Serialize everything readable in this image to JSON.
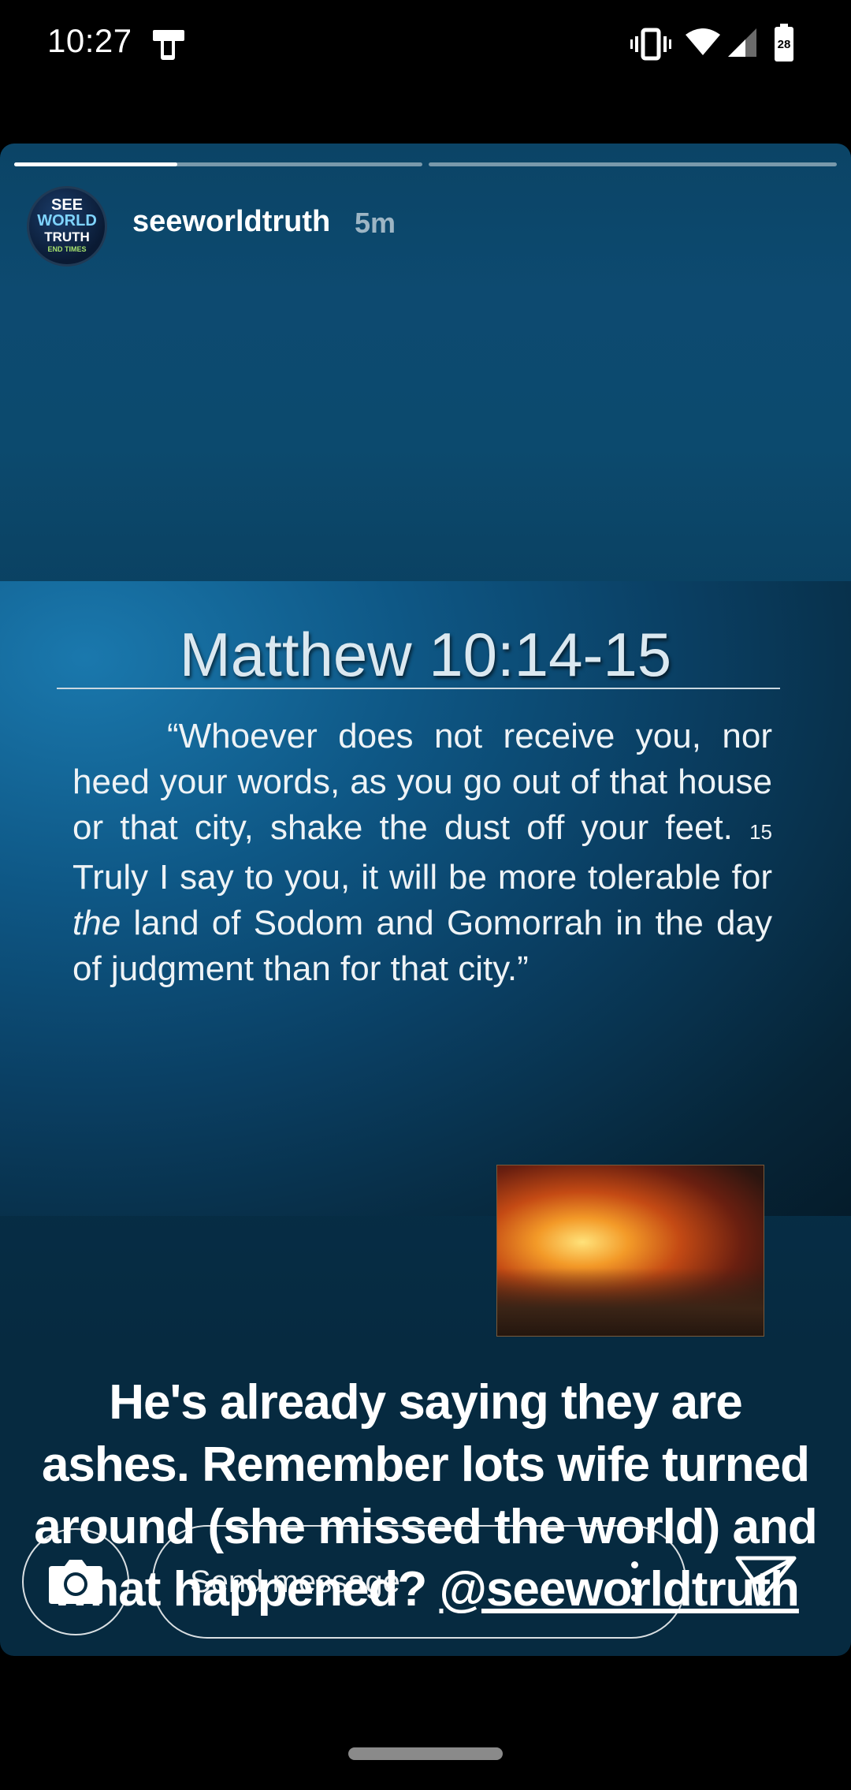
{
  "status_bar": {
    "time": "10:27",
    "battery_level": "28",
    "icons": [
      "screenshot-device-icon",
      "vibrate-icon",
      "wifi-icon",
      "cell-signal-icon",
      "battery-icon"
    ]
  },
  "story": {
    "progress": [
      {
        "fill": 0.4
      },
      {
        "fill": 0
      }
    ],
    "avatar_lines": [
      "SEE",
      "WORLD",
      "TRUTH",
      "END TIMES"
    ],
    "username": "seeworldtruth",
    "time_ago": "5m",
    "slide": {
      "title": "Matthew 10:14-15",
      "verse_part1": "“Whoever does not receive you, nor heed your words, as you go out of that house or that city, shake the dust off your feet. ",
      "verse_number": "15",
      "verse_part2": " Truly I say to you, it will be more tolerable for ",
      "verse_italic": "the",
      "verse_part3": " land of Sodom and Gomorrah in the day of judgment than for that city.”"
    },
    "caption_text": "He's already saying they are ashes. Remember lots wife turned around (she missed the world) and what happened? ",
    "caption_mention": "@seeworldtruth"
  },
  "bottom_bar": {
    "message_placeholder": "Send message",
    "icons": [
      "camera-icon",
      "more-options-icon",
      "send-icon"
    ]
  },
  "colors": {
    "story_top": "#0b4466",
    "story_bottom": "#062a40",
    "text": "#ffffff"
  }
}
